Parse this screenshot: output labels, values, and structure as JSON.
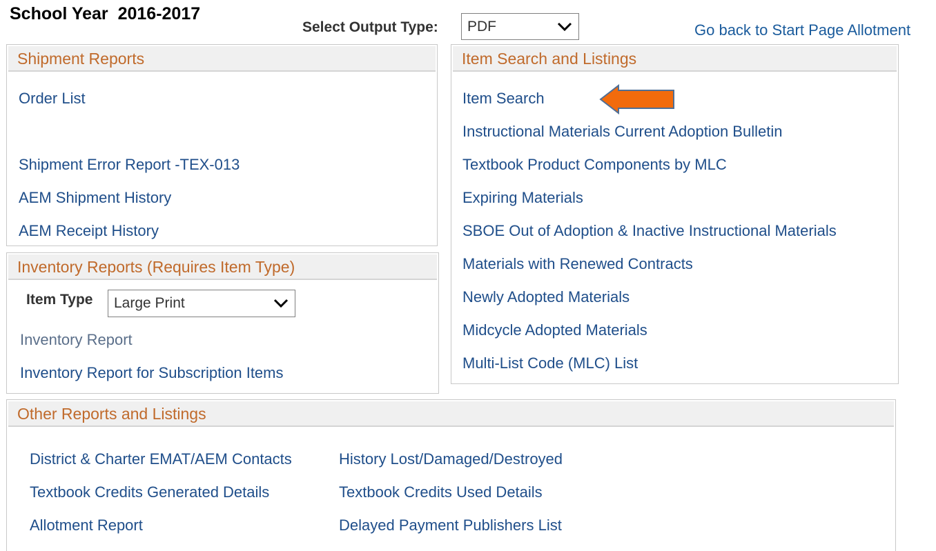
{
  "header": {
    "school_year_label": "School Year",
    "school_year_value": "2016-2017",
    "output_type_label": "Select Output Type:",
    "output_type_value": "PDF",
    "start_page_link": "Go back to Start Page Allotment"
  },
  "shipment": {
    "title": "Shipment Reports",
    "links": [
      "Order List",
      "Shipment Error Report -TEX-013",
      "AEM Shipment History",
      "AEM Receipt History"
    ]
  },
  "inventory": {
    "title": "Inventory Reports (Requires Item Type)",
    "item_type_label": "Item Type",
    "item_type_value": "Large Print",
    "links": [
      "Inventory Report",
      "Inventory Report for Subscription Items"
    ]
  },
  "item_search": {
    "title": "Item Search and Listings",
    "links": [
      "Item Search",
      "Instructional Materials Current Adoption Bulletin",
      "Textbook Product Components by MLC",
      "Expiring Materials",
      "SBOE Out of Adoption & Inactive Instructional Materials",
      "Materials with Renewed Contracts",
      "Newly Adopted Materials",
      "Midcycle Adopted Materials",
      "Multi-List Code (MLC) List"
    ]
  },
  "other": {
    "title": "Other Reports and Listings",
    "col1": [
      "District & Charter EMAT/AEM Contacts",
      "Textbook Credits Generated Details",
      "Allotment Report"
    ],
    "col2": [
      "History Lost/Damaged/Destroyed",
      "Textbook Credits Used Details",
      "Delayed Payment Publishers List"
    ]
  },
  "icons": {
    "dropdown": "chevron-down-icon",
    "pointer": "arrow-left-icon"
  },
  "colors": {
    "panel_title": "#c06a2b",
    "link": "#1f4e8a",
    "arrow_fill": "#f26b0c",
    "arrow_stroke": "#4f6f96"
  }
}
